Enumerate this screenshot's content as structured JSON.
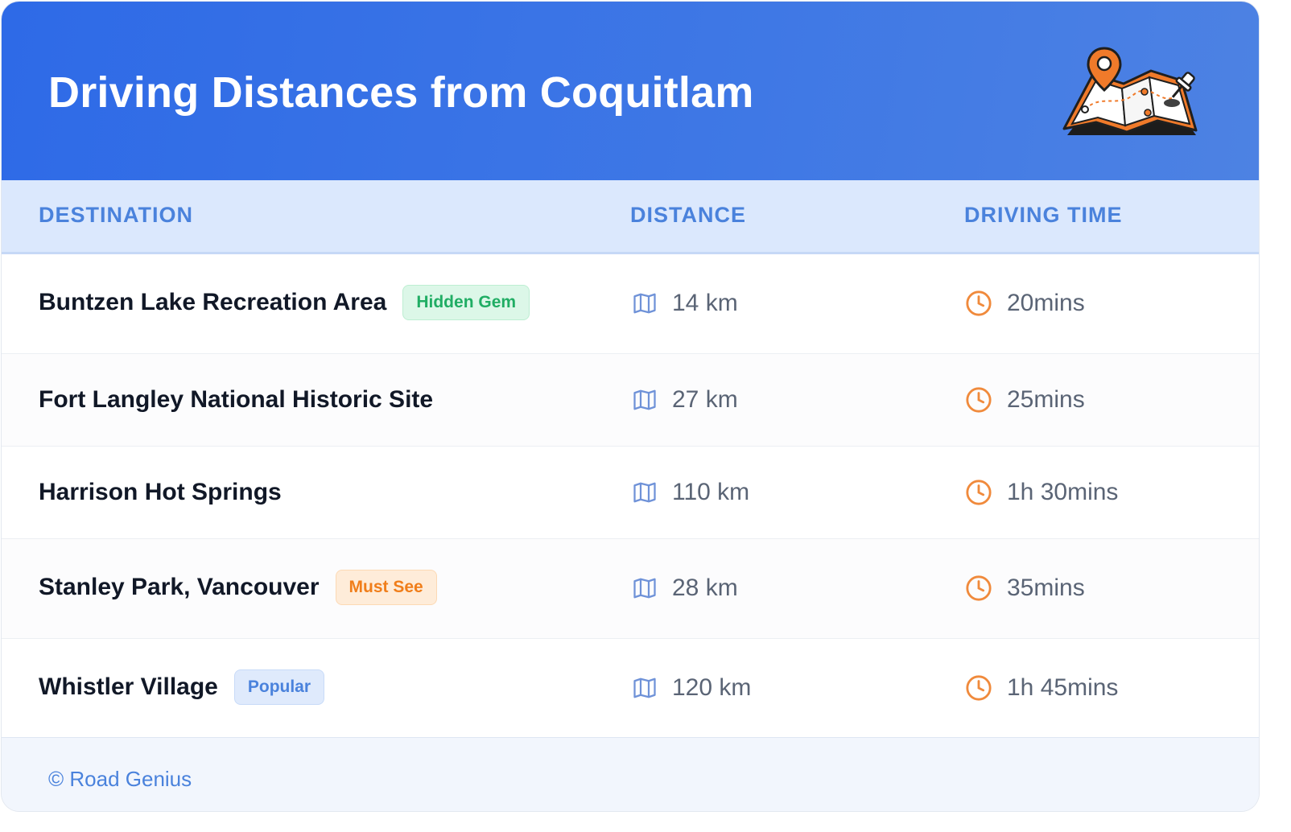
{
  "header": {
    "title": "Driving Distances from Coquitlam",
    "illustration_icon": "map-with-pin-icon"
  },
  "columns": {
    "destination": "DESTINATION",
    "distance": "DISTANCE",
    "driving_time": "DRIVING TIME"
  },
  "rows": [
    {
      "name": "Buntzen Lake Recreation Area",
      "badge": "Hidden Gem",
      "badge_color": "#20ad64",
      "distance": "14 km",
      "time": "20mins"
    },
    {
      "name": "Fort Langley National Historic Site",
      "badge": "",
      "distance": "27 km",
      "time": "25mins"
    },
    {
      "name": "Harrison Hot Springs",
      "badge": "",
      "distance": "110 km",
      "time": "1h 30mins"
    },
    {
      "name": "Stanley Park, Vancouver",
      "badge": "Must See",
      "badge_color": "#f07e1a",
      "distance": "28 km",
      "time": "35mins"
    },
    {
      "name": "Whistler Village",
      "badge": "Popular",
      "badge_color": "#4a82dc",
      "distance": "120 km",
      "time": "1h 45mins"
    }
  ],
  "icons": {
    "distance": "map-icon",
    "time": "clock-icon"
  },
  "footer": {
    "text": "© Road Genius"
  },
  "colors": {
    "header_blue": "#2e6ae7",
    "accent_blue": "#4a82dc",
    "accent_orange": "#f08a3c",
    "table_header_bg": "#dbe8fd"
  }
}
